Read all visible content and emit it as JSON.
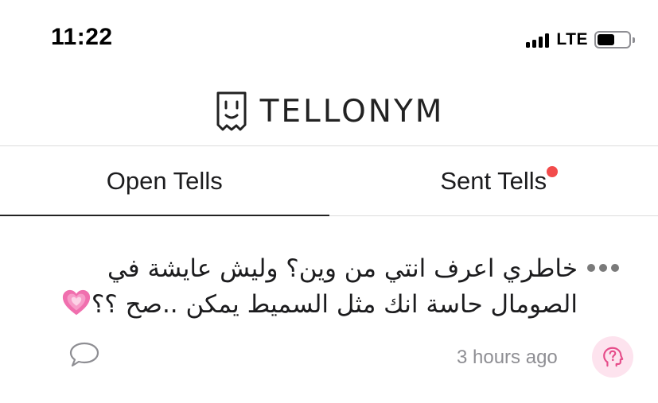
{
  "status_bar": {
    "time": "11:22",
    "network": "LTE",
    "battery_level": 0.55
  },
  "brand": {
    "name": "TELLONYM",
    "icon": "tellonym-logo-icon"
  },
  "tabs": [
    {
      "label": "Open Tells",
      "active": true
    },
    {
      "label": "Sent Tells",
      "active": false,
      "notification": true
    }
  ],
  "tell": {
    "text": "خاطري اعرف انتي من وين؟ وليش عايشة في الصومال حاسة انك مثل السميط يمكن ..صح ؟؟",
    "emoji": "growing-heart-icon",
    "timestamp": "3 hours ago",
    "icons": {
      "more": "more-dots-icon",
      "comment": "comment-bubble-icon",
      "profile": "question-head-icon"
    }
  },
  "colors": {
    "accent_dot": "#f24b4b",
    "profile_bg": "#fde3ee",
    "profile_icon": "#e64d8a",
    "muted_text": "#8e8e93"
  }
}
